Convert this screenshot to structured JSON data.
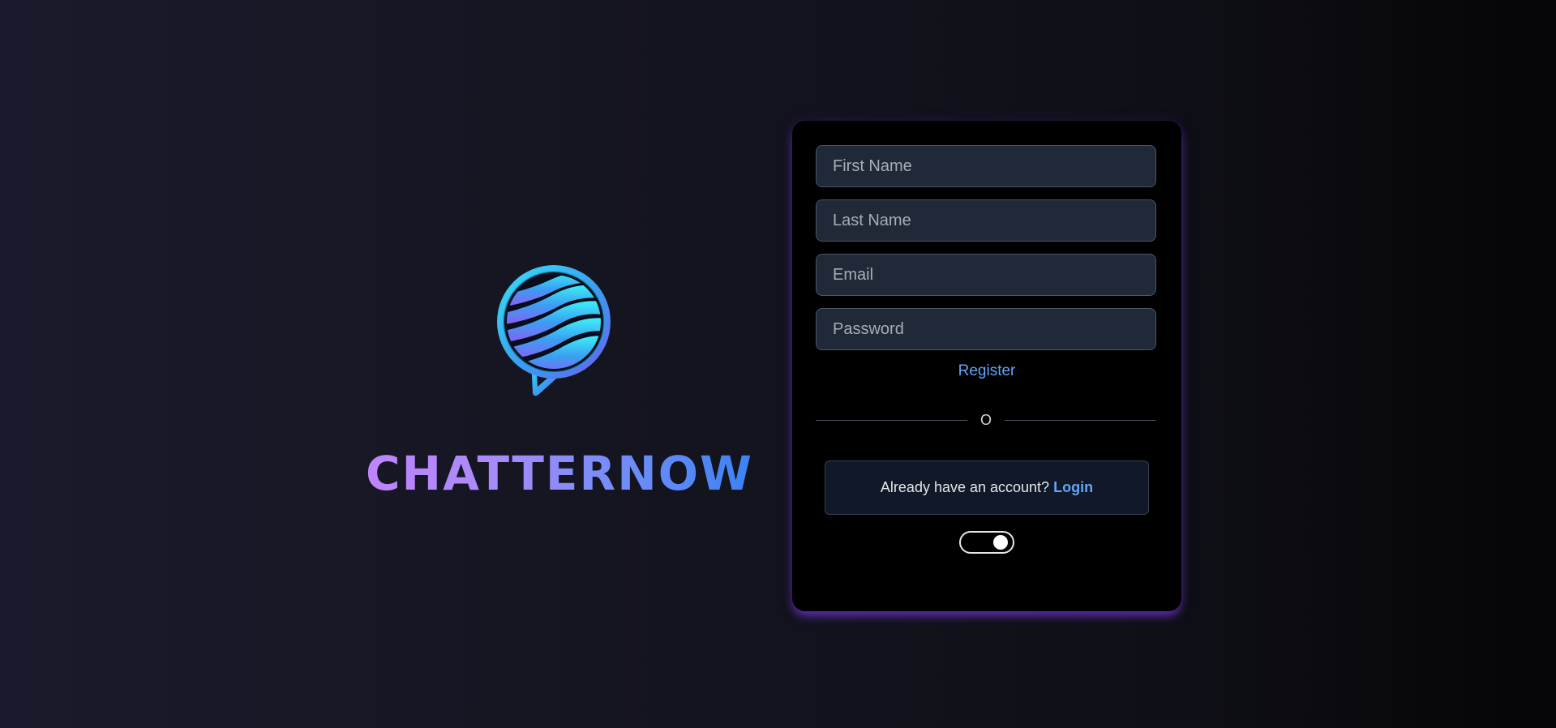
{
  "brand": {
    "name": "CHATTERNOW",
    "logo_icon": "chat-bubble-globe-icon"
  },
  "form": {
    "first_name_placeholder": "First Name",
    "last_name_placeholder": "Last Name",
    "email_placeholder": "Email",
    "password_placeholder": "Password",
    "register_label": "Register",
    "divider_text": "O",
    "account_prompt": "Already have an account?",
    "login_label": "Login"
  },
  "theme_toggle": {
    "state": "on",
    "icon": "toggle-switch-icon"
  },
  "colors": {
    "accent": "#60a5fa",
    "glow": "#7c3aed",
    "input_bg": "#1f2937",
    "card_bg": "#000000",
    "wordmark_start": "#c084fc",
    "wordmark_end": "#3b82f6"
  }
}
